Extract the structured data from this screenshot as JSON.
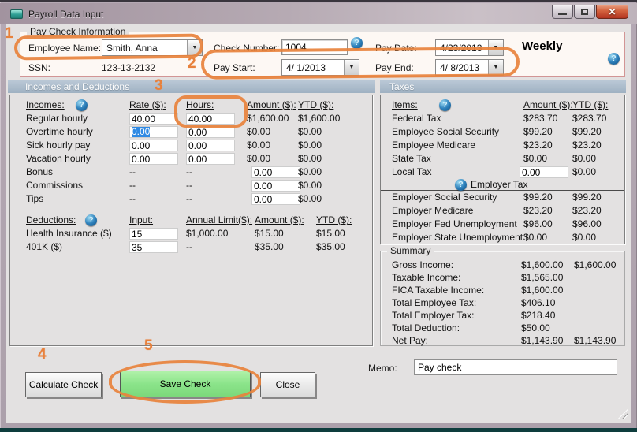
{
  "window": {
    "title": "Payroll Data Input"
  },
  "icons": {
    "dropdown": "▼",
    "help": "?",
    "close": "✕"
  },
  "colors": {
    "annotation_orange": "#E8823C",
    "save_button_green": "#8BE48A",
    "section_header_bg": "#A6B7C6",
    "groupbox_border_pink": "#D29595",
    "help_icon_blue": "#2F82BD",
    "close_button_red": "#B23420",
    "selection_blue": "#2F8AE4"
  },
  "annotations": {
    "n1": "1",
    "n2": "2",
    "n3": "3",
    "n4": "4",
    "n5": "5"
  },
  "paycheck": {
    "group_label": "Pay Check Information",
    "employee_name": {
      "label": "Employee Name:",
      "value": "Smith, Anna"
    },
    "ssn": {
      "label": "SSN:",
      "value": "123-13-2132"
    },
    "check_number": {
      "label": "Check Number:",
      "value": "1004"
    },
    "pay_date": {
      "label": "Pay Date:",
      "value": "4/23/2013"
    },
    "pay_start": {
      "label": "Pay Start:",
      "value": "4/ 1/2013"
    },
    "pay_end": {
      "label": "Pay End:",
      "value": "4/ 8/2013"
    },
    "frequency": "Weekly"
  },
  "section_headers": {
    "left": "Incomes and Deductions",
    "right": "Taxes"
  },
  "incomes": {
    "headers": {
      "items": "Incomes:",
      "rate": "Rate ($):",
      "hours": "Hours:",
      "amount": "Amount ($):",
      "ytd": "YTD ($):"
    },
    "rows": [
      {
        "label": "Regular hourly",
        "rate": "40.00",
        "hours": "40.00",
        "amount": "$1,600.00",
        "ytd": "$1,600.00"
      },
      {
        "label": "Overtime hourly",
        "rate": "0.00",
        "hours": "0.00",
        "amount": "$0.00",
        "ytd": "$0.00"
      },
      {
        "label": "Sick hourly pay",
        "rate": "0.00",
        "hours": "0.00",
        "amount": "$0.00",
        "ytd": "$0.00"
      },
      {
        "label": "Vacation hourly",
        "rate": "0.00",
        "hours": "0.00",
        "amount": "$0.00",
        "ytd": "$0.00"
      },
      {
        "label": "Bonus",
        "rate": "--",
        "hours": "--",
        "amount": "0.00",
        "ytd": "$0.00"
      },
      {
        "label": "Commissions",
        "rate": "--",
        "hours": "--",
        "amount": "0.00",
        "ytd": "$0.00"
      },
      {
        "label": "Tips",
        "rate": "--",
        "hours": "--",
        "amount": "0.00",
        "ytd": "$0.00"
      }
    ]
  },
  "deductions": {
    "headers": {
      "items": "Deductions:",
      "input": "Input:",
      "limit": "Annual Limit($):",
      "amount": "Amount ($):",
      "ytd": "YTD ($):"
    },
    "rows": [
      {
        "label": "Health Insurance  ($)",
        "input": "15",
        "limit": "$1,000.00",
        "amount": "$15.00",
        "ytd": "$15.00"
      },
      {
        "label": "401K  ($)",
        "input": "35",
        "limit": "--",
        "amount": "$35.00",
        "ytd": "$35.00"
      }
    ]
  },
  "taxes": {
    "headers": {
      "items": "Items:",
      "amount": "Amount ($):",
      "ytd": "YTD ($):"
    },
    "employee_rows": [
      {
        "label": "Federal Tax",
        "amount": "$283.70",
        "ytd": "$283.70"
      },
      {
        "label": "Employee Social Security",
        "amount": "$99.20",
        "ytd": "$99.20"
      },
      {
        "label": "Employee Medicare",
        "amount": "$23.20",
        "ytd": "$23.20"
      },
      {
        "label": "State Tax",
        "amount": "$0.00",
        "ytd": "$0.00"
      },
      {
        "label": "Local Tax",
        "amount": "0.00",
        "ytd": "$0.00"
      }
    ],
    "employer_header": "Employer Tax",
    "employer_rows": [
      {
        "label": "Employer Social Security",
        "amount": "$99.20",
        "ytd": "$99.20"
      },
      {
        "label": "Employer Medicare",
        "amount": "$23.20",
        "ytd": "$23.20"
      },
      {
        "label": "Employer Fed Unemployment",
        "amount": "$96.00",
        "ytd": "$96.00"
      },
      {
        "label": "Employer State Unemployment",
        "amount": "$0.00",
        "ytd": "$0.00"
      }
    ]
  },
  "summary": {
    "group_label": "Summary",
    "rows": [
      {
        "label": "Gross Income:",
        "v1": "$1,600.00",
        "v2": "$1,600.00"
      },
      {
        "label": "Taxable Income:",
        "v1": "$1,565.00",
        "v2": ""
      },
      {
        "label": "FICA Taxable Income:",
        "v1": "$1,600.00",
        "v2": ""
      },
      {
        "label": "Total Employee Tax:",
        "v1": "$406.10",
        "v2": ""
      },
      {
        "label": "Total Employer Tax:",
        "v1": "$218.40",
        "v2": ""
      },
      {
        "label": "Total Deduction:",
        "v1": "$50.00",
        "v2": ""
      },
      {
        "label": "Net Pay:",
        "v1": "$1,143.90",
        "v2": "$1,143.90"
      }
    ]
  },
  "buttons": {
    "calculate": "Calculate Check",
    "save": "Save Check",
    "close": "Close"
  },
  "memo": {
    "label": "Memo:",
    "value": "Pay check"
  }
}
